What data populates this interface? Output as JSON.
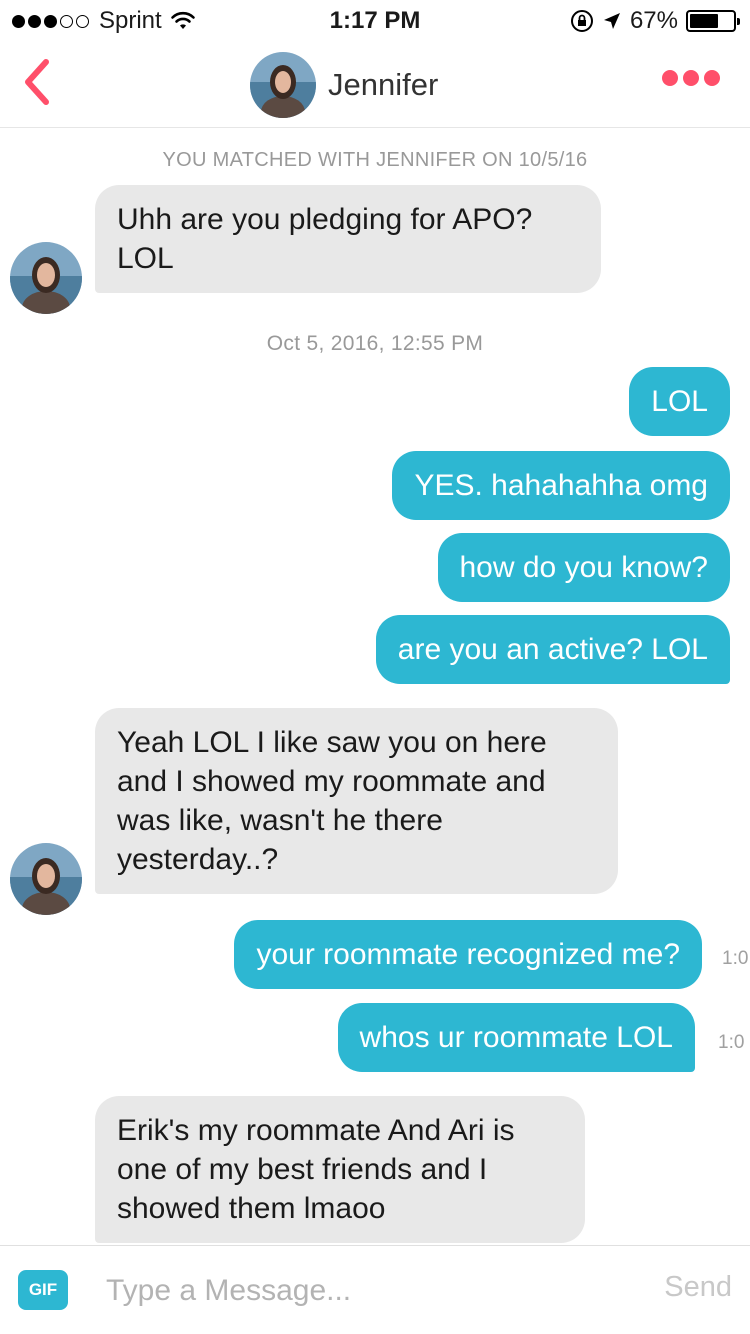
{
  "status_bar": {
    "carrier": "Sprint",
    "time": "1:17 PM",
    "battery": "67%",
    "battery_level": 0.67,
    "signal_bars_filled": 3,
    "signal_bars_total": 5
  },
  "header": {
    "back_icon": "chevron-left-icon",
    "name": "Jennifer",
    "more_icon": "more-dots-icon",
    "accent_color": "#ff4f6a"
  },
  "thread": {
    "match_notice": "YOU MATCHED WITH JENNIFER ON 10/5/16",
    "date_separator": "Oct 5, 2016, 12:55 PM",
    "messages": [
      {
        "from": "them",
        "text": "Uhh are you pledging for APO? LOL"
      },
      {
        "from": "me",
        "text": "LOL"
      },
      {
        "from": "me",
        "text": "YES. hahahahha omg"
      },
      {
        "from": "me",
        "text": "how do you know?"
      },
      {
        "from": "me",
        "text": "are you an active? LOL"
      },
      {
        "from": "them",
        "text": "Yeah LOL I like saw you on here and I showed my roommate and was like, wasn't he there yesterday..?"
      },
      {
        "from": "me",
        "text": "your roommate recognized me?",
        "time": "1:0"
      },
      {
        "from": "me",
        "text": "whos ur roommate LOL",
        "time": "1:0"
      },
      {
        "from": "them",
        "text": "Erik's my roommate And Ari is one of my best friends and I showed them lmaoo"
      }
    ],
    "outgoing_color": "#2db7d2",
    "incoming_color": "#e8e8e8"
  },
  "compose": {
    "gif_label": "GIF",
    "placeholder": "Type a Message...",
    "send_label": "Send"
  }
}
